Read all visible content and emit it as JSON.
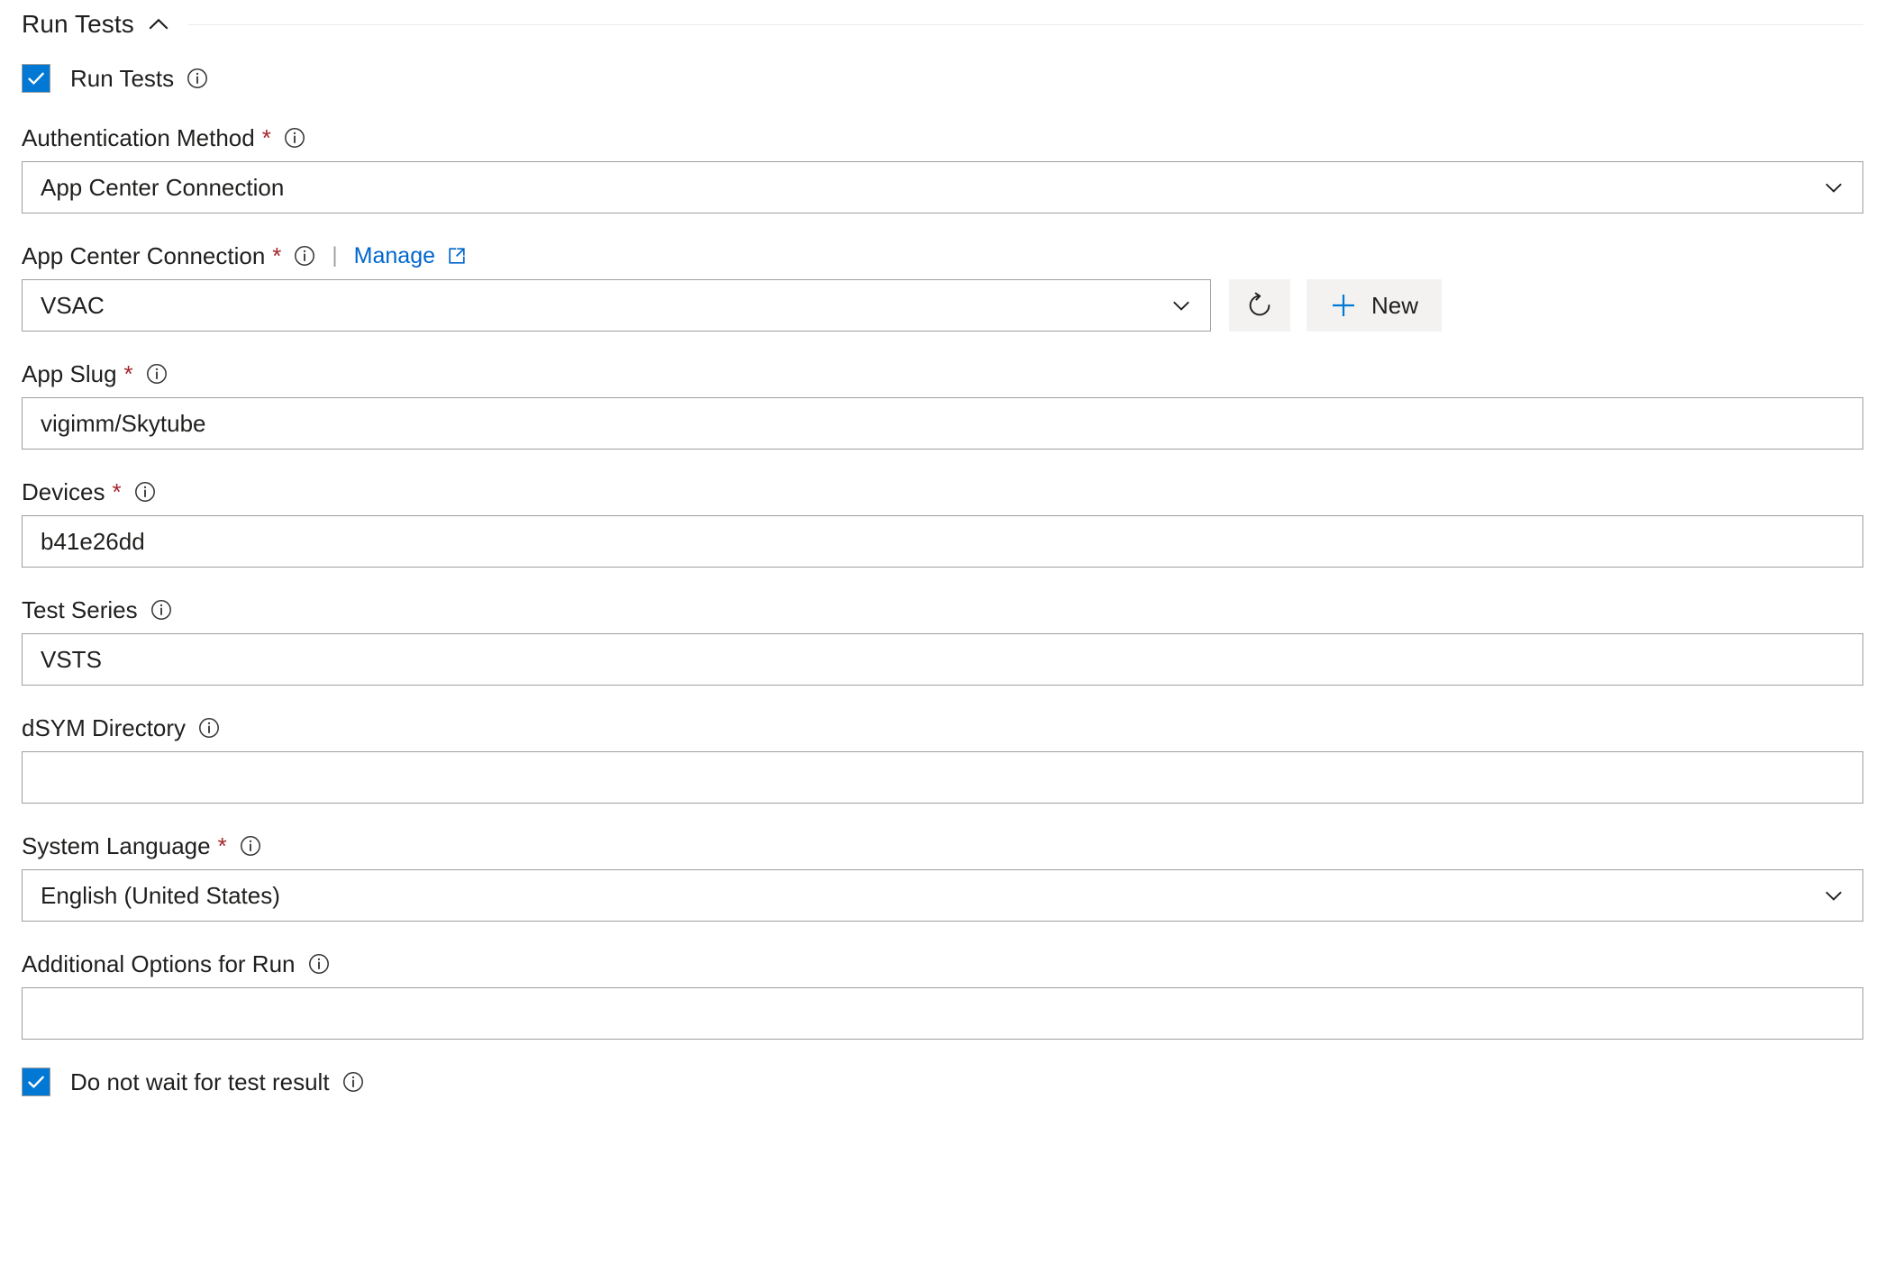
{
  "section": {
    "title": "Run Tests",
    "collapse_icon": "chevron-up-icon"
  },
  "run_tests_checkbox": {
    "label": "Run Tests",
    "checked": true,
    "info_icon": "info-icon"
  },
  "fields": {
    "authentication_method": {
      "label": "Authentication Method",
      "required": "*",
      "value": "App Center Connection",
      "type": "dropdown",
      "info_icon": "info-icon",
      "caret_icon": "chevron-down-icon"
    },
    "app_center_connection": {
      "label": "App Center Connection",
      "required": "*",
      "value": "VSAC",
      "type": "dropdown",
      "info_icon": "info-icon",
      "separator": "|",
      "manage_label": "Manage",
      "manage_icon": "external-link-icon",
      "caret_icon": "chevron-down-icon",
      "refresh_icon": "refresh-icon",
      "new_label": "New",
      "new_icon": "plus-icon"
    },
    "app_slug": {
      "label": "App Slug",
      "required": "*",
      "value": "vigimm/Skytube",
      "type": "text",
      "info_icon": "info-icon"
    },
    "devices": {
      "label": "Devices",
      "required": "*",
      "value": "b41e26dd",
      "type": "text",
      "info_icon": "info-icon"
    },
    "test_series": {
      "label": "Test Series",
      "required": "",
      "value": "VSTS",
      "type": "text",
      "info_icon": "info-icon"
    },
    "dsym_directory": {
      "label": "dSYM Directory",
      "required": "",
      "value": "",
      "type": "text",
      "info_icon": "info-icon"
    },
    "system_language": {
      "label": "System Language",
      "required": "*",
      "value": "English (United States)",
      "type": "dropdown",
      "info_icon": "info-icon",
      "caret_icon": "chevron-down-icon"
    },
    "additional_options": {
      "label": "Additional Options for Run",
      "required": "",
      "value": "",
      "type": "text",
      "info_icon": "info-icon"
    }
  },
  "do_not_wait_checkbox": {
    "label": "Do not wait for test result",
    "checked": true,
    "info_icon": "info-icon"
  },
  "colors": {
    "accent": "#0078d4",
    "link": "#0066cc",
    "required_star": "#a4262c",
    "border": "#a19f9d",
    "button_bg": "#f3f2f1",
    "divider": "#ebebeb",
    "text": "#201f1e"
  }
}
